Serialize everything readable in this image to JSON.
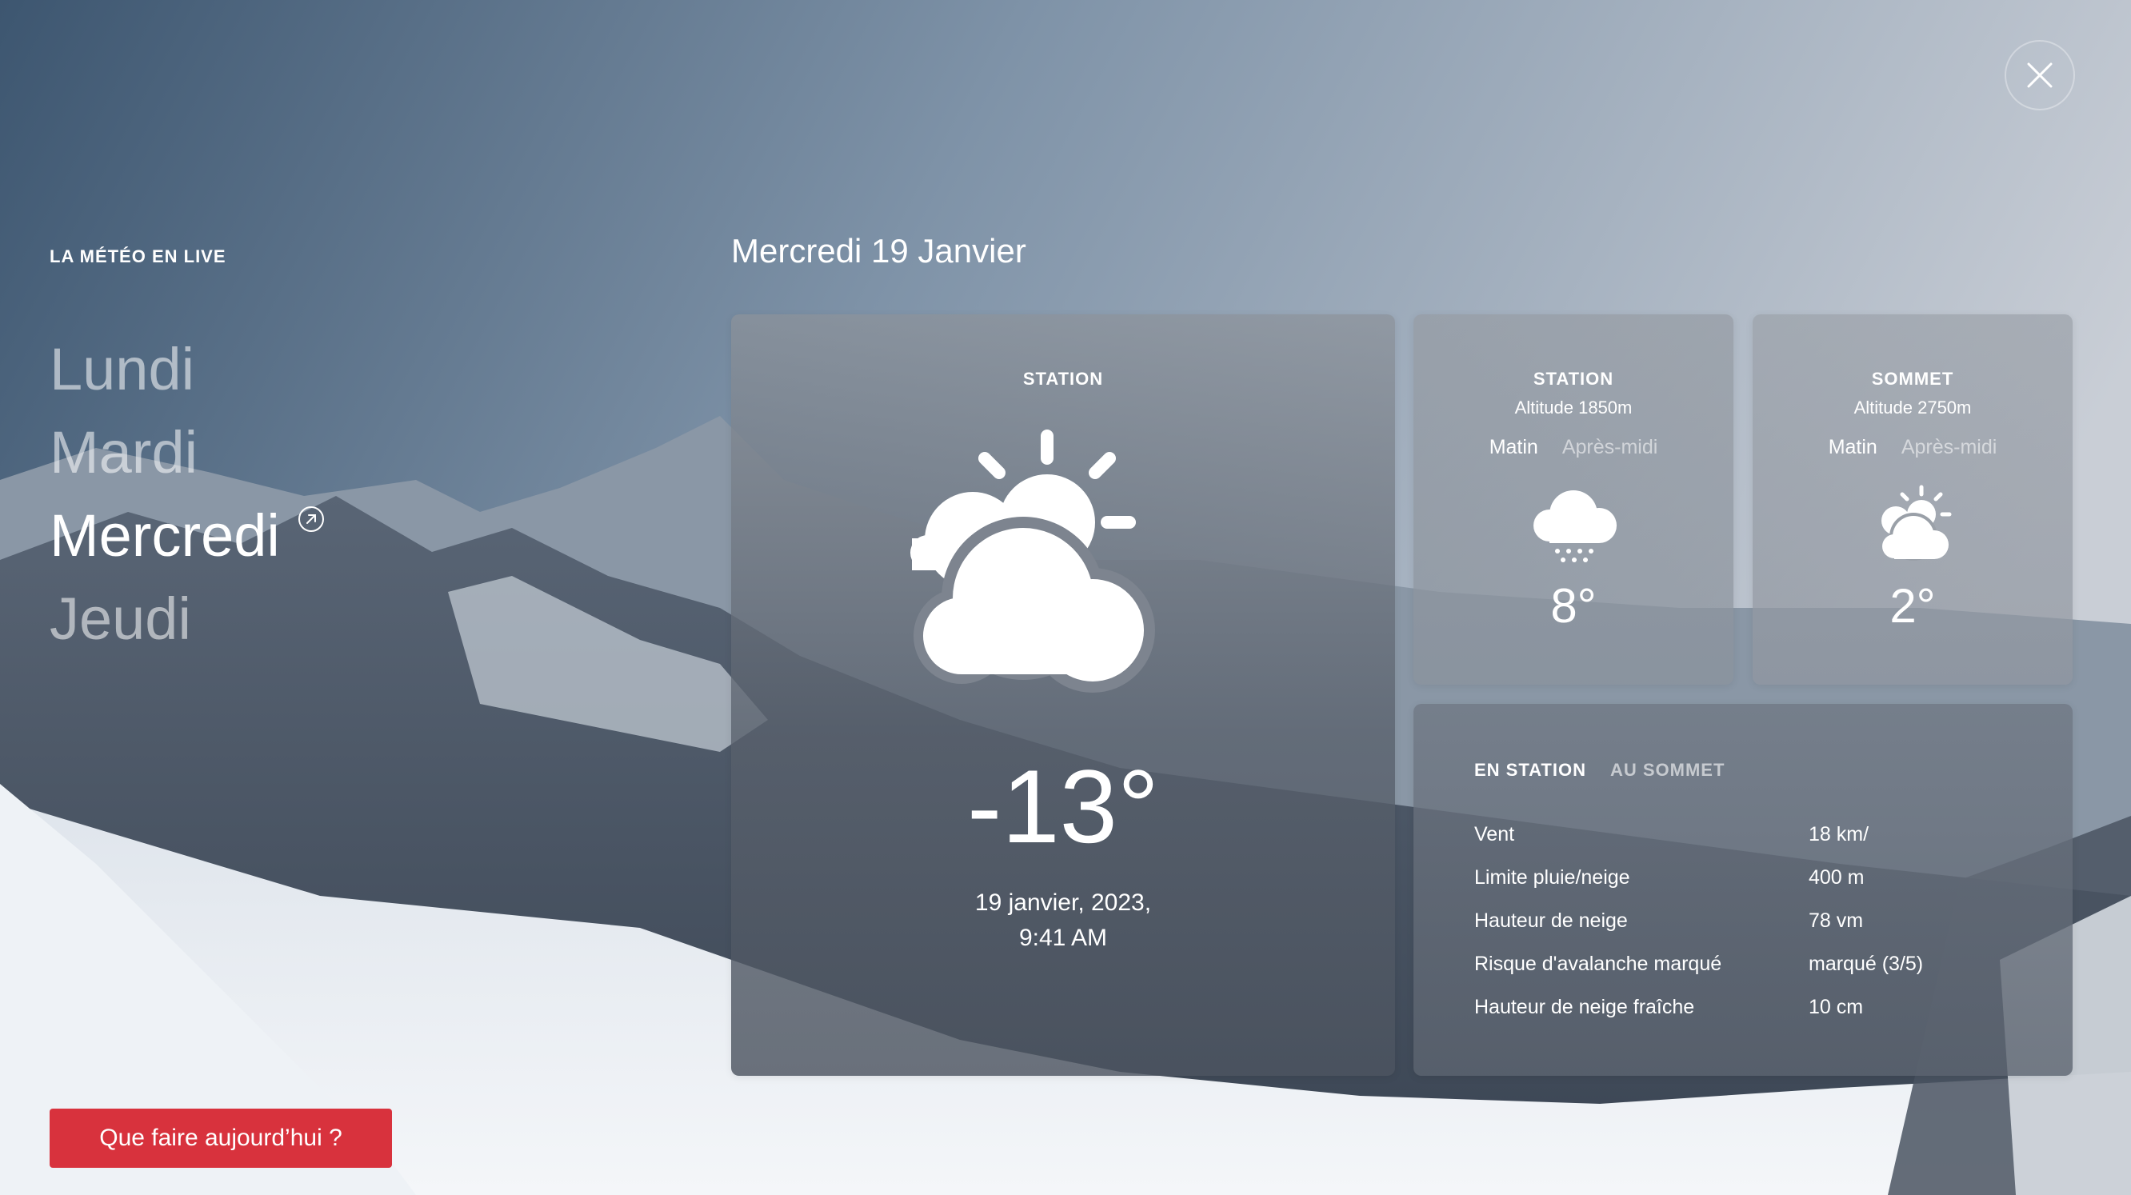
{
  "sidebar": {
    "section_label": "LA MÉTÉO EN LIVE",
    "days": [
      "Lundi",
      "Mardi",
      "Mercredi",
      "Jeudi"
    ],
    "active_day": "Mercredi",
    "cta_label": "Que faire aujourd’hui ?"
  },
  "main": {
    "date_title": "Mercredi 19 Janvier",
    "card": {
      "label": "STATION",
      "temperature": "-13°",
      "date_line": "19 janvier, 2023,",
      "time_line": "9:41 AM",
      "icon": "partly-cloudy-icon"
    }
  },
  "station_card": {
    "label": "STATION",
    "altitude": "Altitude 1850m",
    "tab_morning": "Matin",
    "tab_afternoon": "Après-midi",
    "temperature": "8°",
    "icon": "snow-cloud-icon"
  },
  "summit_card": {
    "label": "SOMMET",
    "altitude": "Altitude 2750m",
    "tab_morning": "Matin",
    "tab_afternoon": "Après-midi",
    "temperature": "2°",
    "icon": "partly-cloudy-icon"
  },
  "details": {
    "tab_station": "EN STATION",
    "tab_summit": "AU SOMMET",
    "rows": [
      {
        "label": "Vent",
        "value": "18 km/"
      },
      {
        "label": "Limite pluie/neige",
        "value": "400 m"
      },
      {
        "label": "Hauteur de neige",
        "value": "78 vm"
      },
      {
        "label": "Risque d'avalanche marqué",
        "value": "marqué (3/5)"
      },
      {
        "label": "Hauteur de neige fraîche",
        "value": "10 cm"
      }
    ]
  },
  "colors": {
    "cta": "#d8323d",
    "text": "#ffffff"
  }
}
